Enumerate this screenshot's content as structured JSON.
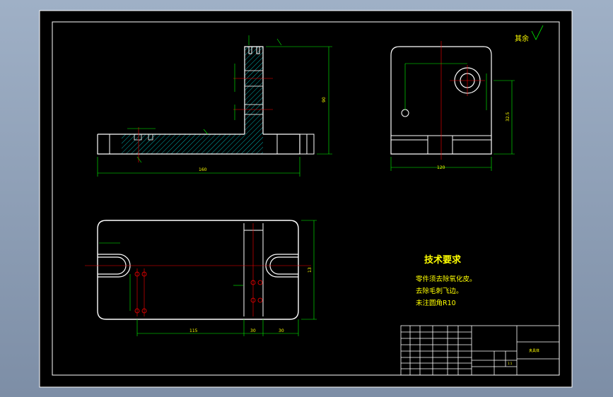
{
  "sheet": {
    "surface_roughness_note": "其余",
    "tech_requirements": {
      "title": "技术要求",
      "items": [
        "零件须去除氧化皮。",
        "去除毛刺飞边。",
        "未注圆角R10"
      ]
    }
  },
  "dimensions": {
    "front_overall_length": "160",
    "front_overall_height": "90",
    "side_width": "120",
    "side_height": "32.5",
    "top_length_left": "115",
    "top_height": "13",
    "top_offset": "30",
    "top_width_right": "30"
  },
  "title_block": {
    "part_name": "夹具体",
    "scale": "1:1"
  },
  "colors": {
    "background": "#000000",
    "outline": "#ffffff",
    "dimension": "#00ff00",
    "centerline": "#ff0000",
    "hatch": "#00ffff",
    "text": "#ffff00"
  }
}
